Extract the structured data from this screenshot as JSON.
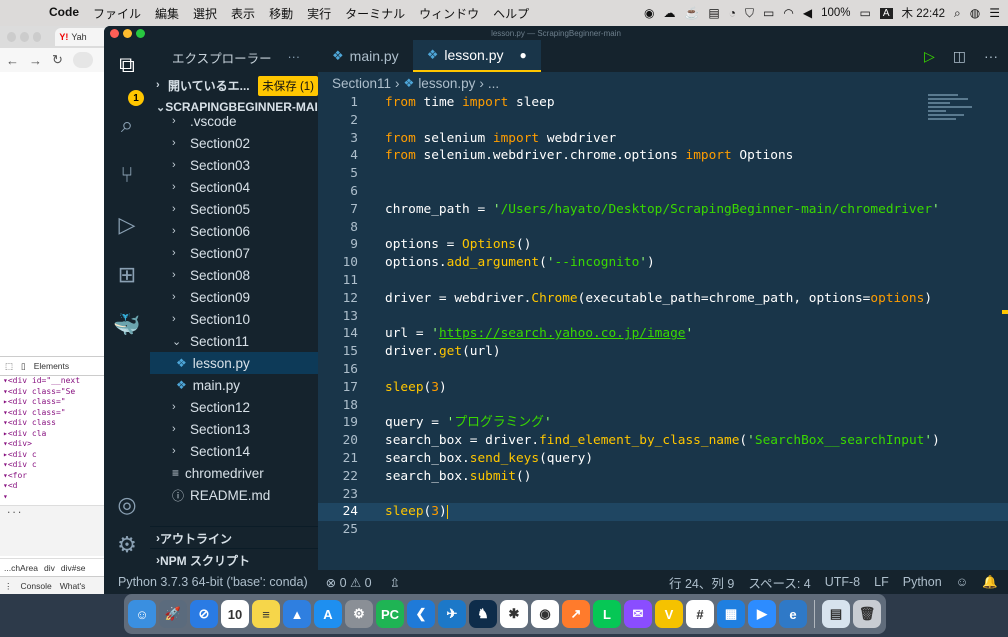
{
  "menubar": {
    "apple": "",
    "app_name": "Code",
    "items": [
      "ファイル",
      "編集",
      "選択",
      "表示",
      "移動",
      "実行",
      "ターミナル",
      "ウィンドウ",
      "ヘルプ"
    ],
    "battery": "100%",
    "ime": "A",
    "clock": "木 22:42"
  },
  "browser": {
    "tab_label": "Yah",
    "devtools_tab": "Elements",
    "dom_lines": [
      "▾<div id=\"__next",
      " ▾<div class=\"Se",
      "  ▸<div class=\"",
      "  ▾<div class=\"",
      "   ▾<div class",
      "    ▸<div cla",
      "    ▾<div>",
      "     ▸<div c",
      "     ▾<div c",
      "      ▾<for",
      "       ▾<d",
      "        ▾"
    ],
    "ellipsis": "...",
    "crumbs": [
      "...chArea",
      "div",
      "div#se"
    ],
    "drawer_tabs": [
      "Console",
      "What's"
    ]
  },
  "window_title": "lesson.py — ScrapingBeginner-main",
  "activity_badge": "1",
  "explorer": {
    "title": "エクスプローラー",
    "more": "···",
    "open_editors": "開いているエ...",
    "unsaved": "未保存 (1)",
    "workspace": "SCRAPINGBEGINNER-MAIN",
    "items": [
      {
        "label": ".vscode",
        "type": "folder",
        "indent": 1
      },
      {
        "label": "Section02",
        "type": "folder",
        "indent": 1
      },
      {
        "label": "Section03",
        "type": "folder",
        "indent": 1
      },
      {
        "label": "Section04",
        "type": "folder",
        "indent": 1
      },
      {
        "label": "Section05",
        "type": "folder",
        "indent": 1
      },
      {
        "label": "Section06",
        "type": "folder",
        "indent": 1
      },
      {
        "label": "Section07",
        "type": "folder",
        "indent": 1
      },
      {
        "label": "Section08",
        "type": "folder",
        "indent": 1
      },
      {
        "label": "Section09",
        "type": "folder",
        "indent": 1
      },
      {
        "label": "Section10",
        "type": "folder",
        "indent": 1
      },
      {
        "label": "Section11",
        "type": "folder-open",
        "indent": 1
      },
      {
        "label": "lesson.py",
        "type": "py",
        "indent": 2,
        "selected": true
      },
      {
        "label": "main.py",
        "type": "py",
        "indent": 2
      },
      {
        "label": "Section12",
        "type": "folder",
        "indent": 1
      },
      {
        "label": "Section13",
        "type": "folder",
        "indent": 1
      },
      {
        "label": "Section14",
        "type": "folder",
        "indent": 1
      },
      {
        "label": "chromedriver",
        "type": "file",
        "indent": 1
      },
      {
        "label": "README.md",
        "type": "info",
        "indent": 1
      }
    ],
    "outline": "アウトライン",
    "npm": "NPM スクリプト"
  },
  "tabs": [
    {
      "label": "main.py",
      "active": false
    },
    {
      "label": "lesson.py",
      "active": true,
      "modified": "●"
    }
  ],
  "breadcrumb": {
    "folder": "Section11",
    "file": "lesson.py",
    "rest": "..."
  },
  "current_line": 24,
  "code_lines": [
    [
      [
        "k",
        "from"
      ],
      [
        "p",
        " time "
      ],
      [
        "k",
        "import"
      ],
      [
        "p",
        " sleep"
      ]
    ],
    [],
    [
      [
        "k",
        "from"
      ],
      [
        "p",
        " selenium "
      ],
      [
        "k",
        "import"
      ],
      [
        "p",
        " webdriver"
      ]
    ],
    [
      [
        "k",
        "from"
      ],
      [
        "p",
        " selenium.webdriver.chrome.options "
      ],
      [
        "k",
        "import"
      ],
      [
        "p",
        " Options"
      ]
    ],
    [],
    [],
    [
      [
        "p",
        "chrome_path = "
      ],
      [
        "sq",
        "'"
      ],
      [
        "s",
        "/Users/hayato/Desktop/ScrapingBeginner-main/chromedriver"
      ],
      [
        "sq",
        "'"
      ]
    ],
    [],
    [
      [
        "p",
        "options = "
      ],
      [
        "f",
        "Options"
      ],
      [
        "p",
        "()"
      ]
    ],
    [
      [
        "p",
        "options."
      ],
      [
        "f",
        "add_argument"
      ],
      [
        "p",
        "("
      ],
      [
        "sq",
        "'"
      ],
      [
        "s",
        "--incognito"
      ],
      [
        "sq",
        "'"
      ],
      [
        "p",
        ")"
      ]
    ],
    [],
    [
      [
        "p",
        "driver = webdriver."
      ],
      [
        "f",
        "Chrome"
      ],
      [
        "p",
        "(executable_path=chrome_path, options="
      ],
      [
        "k",
        "options"
      ],
      [
        "p",
        ")"
      ]
    ],
    [],
    [
      [
        "p",
        "url = "
      ],
      [
        "sq",
        "'"
      ],
      [
        "u",
        "https://search.yahoo.co.jp/image"
      ],
      [
        "sq",
        "'"
      ]
    ],
    [
      [
        "p",
        "driver."
      ],
      [
        "f",
        "get"
      ],
      [
        "p",
        "(url)"
      ]
    ],
    [],
    [
      [
        "f",
        "sleep"
      ],
      [
        "p",
        "("
      ],
      [
        "k",
        "3"
      ],
      [
        "p",
        ")"
      ]
    ],
    [],
    [
      [
        "p",
        "query = "
      ],
      [
        "sq",
        "'"
      ],
      [
        "s",
        "プログラミング"
      ],
      [
        "sq",
        "'"
      ]
    ],
    [
      [
        "p",
        "search_box = driver."
      ],
      [
        "f",
        "find_element_by_class_name"
      ],
      [
        "p",
        "("
      ],
      [
        "sq",
        "'"
      ],
      [
        "s",
        "SearchBox__searchInput"
      ],
      [
        "sq",
        "'"
      ],
      [
        "p",
        ")"
      ]
    ],
    [
      [
        "p",
        "search_box."
      ],
      [
        "f",
        "send_keys"
      ],
      [
        "p",
        "(query)"
      ]
    ],
    [
      [
        "p",
        "search_box."
      ],
      [
        "f",
        "submit"
      ],
      [
        "p",
        "()"
      ]
    ],
    [],
    [
      [
        "f",
        "sleep"
      ],
      [
        "p",
        "("
      ],
      [
        "k",
        "3"
      ],
      [
        "p",
        ")"
      ]
    ],
    []
  ],
  "statusbar": {
    "interpreter": "Python 3.7.3 64-bit ('base': conda)",
    "problems": "⊗ 0 ⚠ 0",
    "position": "行 24、列 9",
    "spaces": "スペース: 4",
    "encoding": "UTF-8",
    "eol": "LF",
    "language": "Python"
  },
  "dock_apps": [
    {
      "name": "finder",
      "color": "#3a8fe0",
      "glyph": "☺"
    },
    {
      "name": "launchpad",
      "color": "#5b6b7d",
      "glyph": "🚀"
    },
    {
      "name": "safari",
      "color": "#2a7be4",
      "glyph": "⊘"
    },
    {
      "name": "calendar",
      "color": "#ffffff",
      "glyph": "10"
    },
    {
      "name": "notes",
      "color": "#f6d64a",
      "glyph": "≡"
    },
    {
      "name": "keynote",
      "color": "#2f7fe0",
      "glyph": "▲"
    },
    {
      "name": "app-store",
      "color": "#1e8ff0",
      "glyph": "A"
    },
    {
      "name": "system-preferences",
      "color": "#8a8f96",
      "glyph": "⚙"
    },
    {
      "name": "pycharm",
      "color": "#1fb454",
      "glyph": "PC"
    },
    {
      "name": "vscode",
      "color": "#1f7ad8",
      "glyph": "❮"
    },
    {
      "name": "testflight",
      "color": "#1c78c8",
      "glyph": "✈"
    },
    {
      "name": "kindle",
      "color": "#0e2c4a",
      "glyph": "♞"
    },
    {
      "name": "slack",
      "color": "#ffffff",
      "glyph": "✱"
    },
    {
      "name": "chrome",
      "color": "#ffffff",
      "glyph": "◉"
    },
    {
      "name": "stocks",
      "color": "#ff7b2c",
      "glyph": "↗"
    },
    {
      "name": "line",
      "color": "#06c755",
      "glyph": "L"
    },
    {
      "name": "messenger",
      "color": "#8a4dff",
      "glyph": "✉"
    },
    {
      "name": "vpn",
      "color": "#f5c200",
      "glyph": "V"
    },
    {
      "name": "slack-app",
      "color": "#ffffff",
      "glyph": "#"
    },
    {
      "name": "trello",
      "color": "#1f7fe0",
      "glyph": "▦"
    },
    {
      "name": "zoom",
      "color": "#2d8cff",
      "glyph": "▶"
    },
    {
      "name": "edge",
      "color": "#2f79c7",
      "glyph": "e"
    },
    {
      "name": "preview",
      "color": "#d7e3ee",
      "glyph": "▤"
    },
    {
      "name": "trash",
      "color": "#c8ccd2",
      "glyph": "🗑"
    }
  ]
}
